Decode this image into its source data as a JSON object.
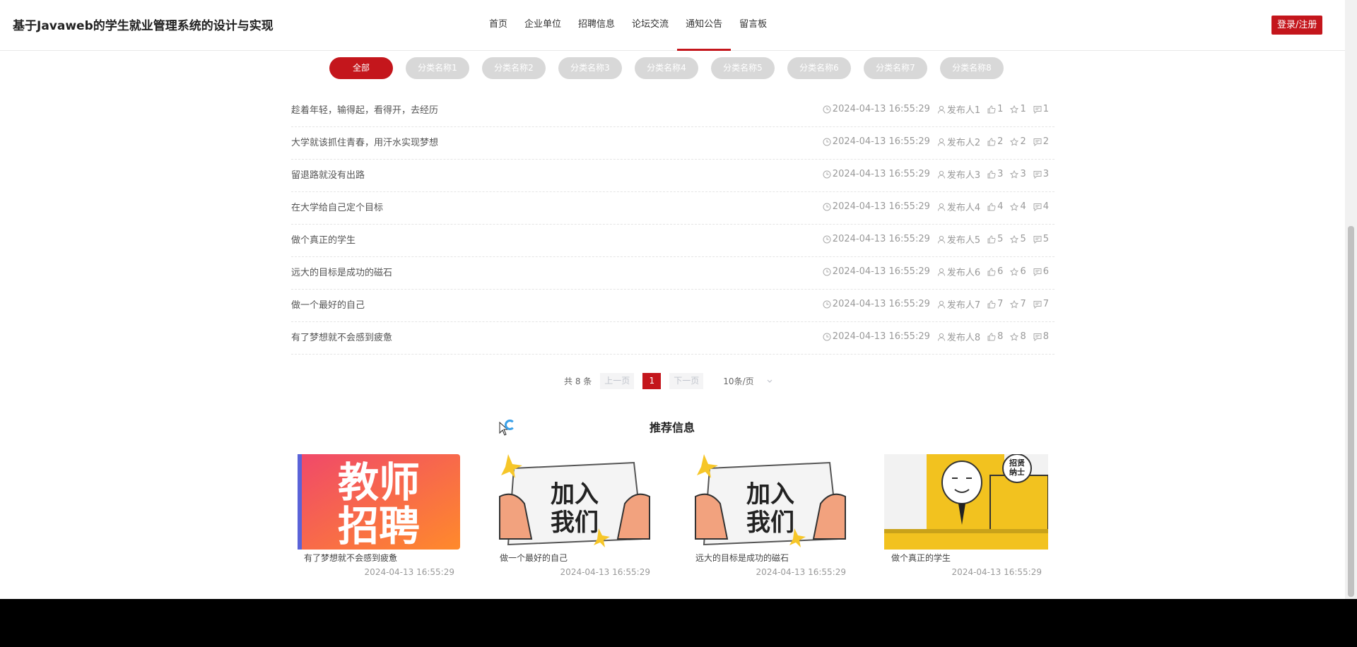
{
  "header": {
    "site_title": "基于Javaweb的学生就业管理系统的设计与实现",
    "nav": [
      "首页",
      "企业单位",
      "招聘信息",
      "论坛交流",
      "通知公告",
      "留言板"
    ],
    "active_nav": "通知公告",
    "login_label": "登录/注册"
  },
  "categories": [
    "全部",
    "分类名称1",
    "分类名称2",
    "分类名称3",
    "分类名称4",
    "分类名称5",
    "分类名称6",
    "分类名称7",
    "分类名称8"
  ],
  "notices": [
    {
      "title": "趁着年轻，输得起，看得开，去经历",
      "time": "2024-04-13 16:55:29",
      "author": "发布人1",
      "likes": "1",
      "stars": "1",
      "comments": "1"
    },
    {
      "title": "大学就该抓住青春，用汗水实现梦想",
      "time": "2024-04-13 16:55:29",
      "author": "发布人2",
      "likes": "2",
      "stars": "2",
      "comments": "2"
    },
    {
      "title": "留退路就没有出路",
      "time": "2024-04-13 16:55:29",
      "author": "发布人3",
      "likes": "3",
      "stars": "3",
      "comments": "3"
    },
    {
      "title": "在大学给自己定个目标",
      "time": "2024-04-13 16:55:29",
      "author": "发布人4",
      "likes": "4",
      "stars": "4",
      "comments": "4"
    },
    {
      "title": "做个真正的学生",
      "time": "2024-04-13 16:55:29",
      "author": "发布人5",
      "likes": "5",
      "stars": "5",
      "comments": "5"
    },
    {
      "title": "远大的目标是成功的磁石",
      "time": "2024-04-13 16:55:29",
      "author": "发布人6",
      "likes": "6",
      "stars": "6",
      "comments": "6"
    },
    {
      "title": "做一个最好的自己",
      "time": "2024-04-13 16:55:29",
      "author": "发布人7",
      "likes": "7",
      "stars": "7",
      "comments": "7"
    },
    {
      "title": "有了梦想就不会感到疲惫",
      "time": "2024-04-13 16:55:29",
      "author": "发布人8",
      "likes": "8",
      "stars": "8",
      "comments": "8"
    }
  ],
  "pagination": {
    "total": "共 8 条",
    "prev": "上一页",
    "current": "1",
    "next": "下一页",
    "page_size": "10条/页"
  },
  "recommend": {
    "title": "推荐信息",
    "items": [
      {
        "title": "有了梦想就不会感到疲惫",
        "date": "2024-04-13 16:55:29",
        "image_text": "教师招聘"
      },
      {
        "title": "做一个最好的自己",
        "date": "2024-04-13 16:55:29",
        "image_text": "加入我们"
      },
      {
        "title": "远大的目标是成功的磁石",
        "date": "2024-04-13 16:55:29",
        "image_text": "加入我们"
      },
      {
        "title": "做个真正的学生",
        "date": "2024-04-13 16:55:29",
        "image_text": "招贤纳士"
      }
    ]
  },
  "colors": {
    "accent": "#c4161c",
    "tab_inactive": "#d8d8d8",
    "footer": "#000000"
  }
}
